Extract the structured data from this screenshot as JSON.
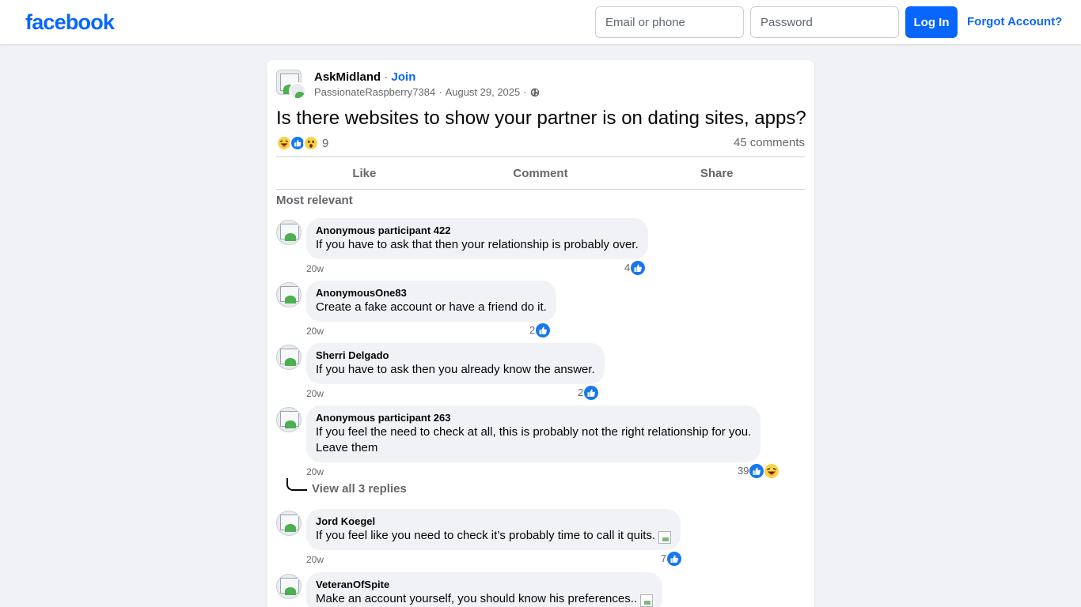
{
  "header": {
    "logo": "facebook",
    "email_placeholder": "Email or phone",
    "password_placeholder": "Password",
    "login_label": "Log In",
    "forgot_label": "Forgot Account?"
  },
  "post": {
    "group_name": "AskMidland",
    "separator": "·",
    "join_label": "Join",
    "author": "PassionateRaspberry7384",
    "date": "August 29, 2025",
    "title": "Is there websites to show your partner is on dating sites, apps?",
    "reaction_count": "9",
    "reaction_icons": [
      "haha",
      "like",
      "wow"
    ],
    "comments_count": "45 comments",
    "actions": {
      "like": "Like",
      "comment": "Comment",
      "share": "Share"
    },
    "sort_label": "Most relevant"
  },
  "comments": [
    {
      "author": "Anonymous participant 422",
      "text": "If you have to ask that then your relationship is probably over.",
      "time": "20w",
      "likes": "4",
      "reactions": [
        "like"
      ]
    },
    {
      "author": "AnonymousOne83",
      "text": "Create a fake account or have a friend do it.",
      "time": "20w",
      "likes": "2",
      "reactions": [
        "like"
      ]
    },
    {
      "author": "Sherri Delgado",
      "text": "If you have to ask then you already know the answer.",
      "time": "20w",
      "likes": "2",
      "reactions": [
        "like"
      ]
    },
    {
      "author": "Anonymous participant 263",
      "text_line1": "If you feel the need to check at all, this is probably not the right relationship for you.",
      "text_line2": "Leave them",
      "time": "20w",
      "likes": "39",
      "reactions": [
        "like",
        "haha"
      ],
      "replies_label": "View all 3 replies"
    },
    {
      "author": "Jord Koegel",
      "text": "If you feel like you need to check it’s probably time to call it quits.",
      "time": "20w",
      "likes": "7",
      "reactions": [
        "like"
      ]
    },
    {
      "author": "VeteranOfSpite",
      "text": "Make an account yourself, you should know his preferences..",
      "time": "",
      "likes": "",
      "reactions": []
    }
  ],
  "colors": {
    "brand": "#0866ff",
    "page_bg": "#f0f2f5",
    "bubble_bg": "#f0f2f5",
    "muted": "#65676b"
  }
}
